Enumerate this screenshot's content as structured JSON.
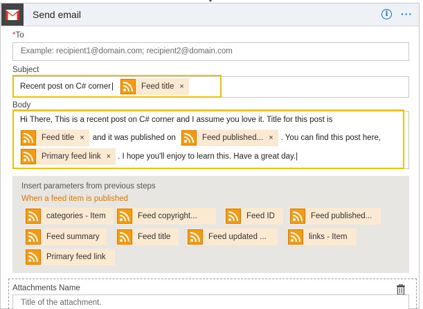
{
  "header": {
    "title": "Send email",
    "info_label": "i",
    "more_label": "···"
  },
  "to": {
    "label": "To",
    "required_mark": "*",
    "placeholder": "Example: recipient1@domain.com; recipient2@domain.com"
  },
  "subject": {
    "label": "Subject",
    "value": "Recent post on C# corner",
    "token": "Feed title",
    "remove": "×"
  },
  "body": {
    "label": "Body",
    "line1": "Hi There, This is a recent post on C# corner and I assume you love it. Title for this post is",
    "token_title": "Feed title",
    "text_mid1": "and it was published on",
    "token_published": "Feed published...",
    "text_mid2": ". You can find this post here,",
    "token_link": "Primary feed link",
    "text_end": ". I hope you'll enjoy to learn this. Have a great day.",
    "remove": "×"
  },
  "params": {
    "title": "Insert parameters from previous steps",
    "subtitle": "When a feed item is published",
    "row1": [
      "categories - Item",
      "Feed copyright...",
      "Feed ID",
      "Feed published..."
    ],
    "row2": [
      "Feed summary",
      "Feed title",
      "Feed updated ...",
      "links - Item"
    ],
    "row3": [
      "Primary feed link"
    ]
  },
  "attachments": {
    "label": "Attachments Name",
    "placeholder": "Title of the attachment."
  },
  "colors": {
    "accent": "#0072c6",
    "highlight": "#f2c200",
    "token_bg": "#fbe9d2",
    "rss": "#f39c12",
    "required": "#d13438",
    "section_title": "#e07800"
  }
}
